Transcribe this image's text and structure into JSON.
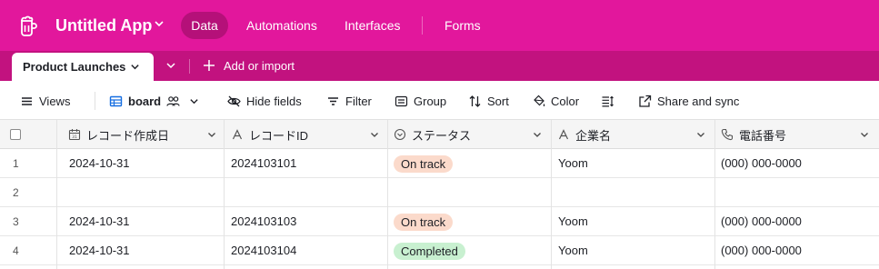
{
  "app": {
    "title": "Untitled App",
    "nav": [
      "Data",
      "Automations",
      "Interfaces",
      "Forms"
    ],
    "active_nav": "Data",
    "accent": "#e2179c"
  },
  "tabs": {
    "active_table": "Product Launches",
    "add_label": "Add or import"
  },
  "toolbar": {
    "views": "Views",
    "view_name": "board",
    "hide_fields": "Hide fields",
    "filter": "Filter",
    "group": "Group",
    "sort": "Sort",
    "color": "Color",
    "share": "Share and sync"
  },
  "columns": [
    {
      "label": "レコード作成日",
      "icon": "calendar-icon"
    },
    {
      "label": "レコードID",
      "icon": "text-icon"
    },
    {
      "label": "ステータス",
      "icon": "select-icon"
    },
    {
      "label": "企業名",
      "icon": "text-icon"
    },
    {
      "label": "電話番号",
      "icon": "phone-icon"
    }
  ],
  "rows": [
    {
      "num": "1",
      "date": "2024-10-31",
      "id": "2024103101",
      "status": "On track",
      "company": "Yoom",
      "phone": "(000) 000-0000"
    },
    {
      "num": "2",
      "date": "",
      "id": "",
      "status": "",
      "company": "",
      "phone": ""
    },
    {
      "num": "3",
      "date": "2024-10-31",
      "id": "2024103103",
      "status": "On track",
      "company": "Yoom",
      "phone": "(000) 000-0000"
    },
    {
      "num": "4",
      "date": "2024-10-31",
      "id": "2024103104",
      "status": "Completed",
      "company": "Yoom",
      "phone": "(000) 000-0000"
    }
  ],
  "status_colors": {
    "On track": {
      "bg": "#fbdacb",
      "fg": "#1d1f25"
    },
    "Completed": {
      "bg": "#c8f0d0",
      "fg": "#1d1f25"
    }
  }
}
